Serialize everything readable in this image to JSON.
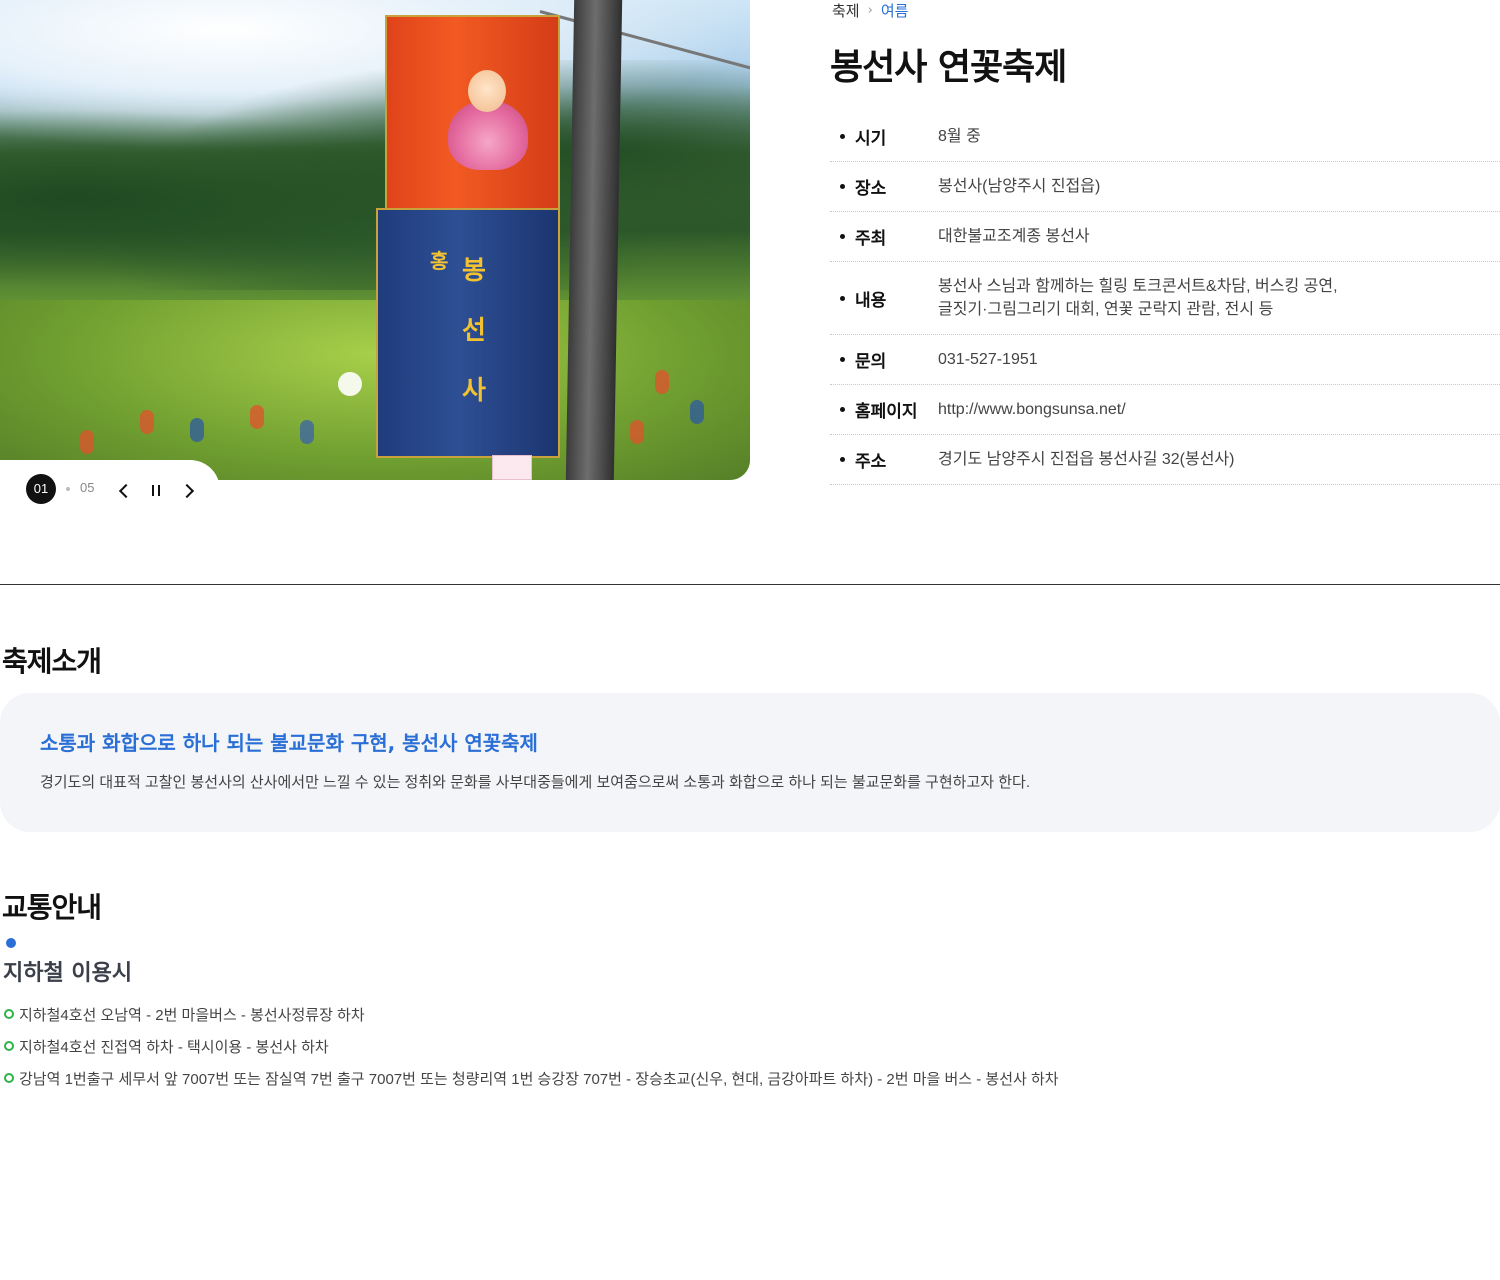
{
  "hero": {
    "slide_current": "01",
    "slide_total": "05"
  },
  "breadcrumb": {
    "parent": "축제",
    "current": "여름"
  },
  "title": "봉선사 연꽃축제",
  "info": [
    {
      "label": "시기",
      "value": "8월 중"
    },
    {
      "label": "장소",
      "value": "봉선사(남양주시 진접읍)"
    },
    {
      "label": "주최",
      "value": "대한불교조계종 봉선사"
    },
    {
      "label": "내용",
      "value_line1": "봉선사 스님과 함께하는 힐링 토크콘서트&차담, 버스킹 공연,",
      "value_line2": "글짓기·그림그리기 대회, 연꽃 군락지 관람, 전시 등"
    },
    {
      "label": "문의",
      "value": "031-527-1951"
    },
    {
      "label": "홈페이지",
      "value": "http://www.bongsunsa.net/"
    },
    {
      "label": "주소",
      "value": "경기도 남양주시 진접읍 봉선사길 32(봉선사)"
    }
  ],
  "intro": {
    "section_title": "축제소개",
    "headline": "소통과 화합으로 하나 되는 불교문화 구현, 봉선사 연꽃축제",
    "text": "경기도의 대표적 고찰인 봉선사의 산사에서만 느낄 수 있는 정취와 문화를 사부대중들에게 보여줌으로써 소통과 화합으로 하나 되는 불교문화를 구현하고자 한다."
  },
  "transport": {
    "section_title": "교통안내",
    "subway_title": "지하철 이용시",
    "routes": [
      "지하철4호선 오남역 - 2번 마을버스 - 봉선사정류장 하차",
      "지하철4호선 진접역 하차 - 택시이용 - 봉선사 하차",
      "강남역 1번출구 세무서 앞 7007번 또는 잠실역 7번 출구 7007번 또는 청량리역 1번 승강장 707번 - 장승초교(신우, 현대, 금강아파트 하차) - 2번 마을 버스 - 봉선사 하차"
    ]
  },
  "icons": {
    "prev": "chevron-left-icon",
    "pause": "pause-icon",
    "next": "chevron-right-icon",
    "breadcrumb_sep": "chevron-right-icon"
  },
  "colors": {
    "accent": "#2a6fd6",
    "route_ring": "#2fb34a",
    "intro_bg": "#f4f5f8"
  }
}
